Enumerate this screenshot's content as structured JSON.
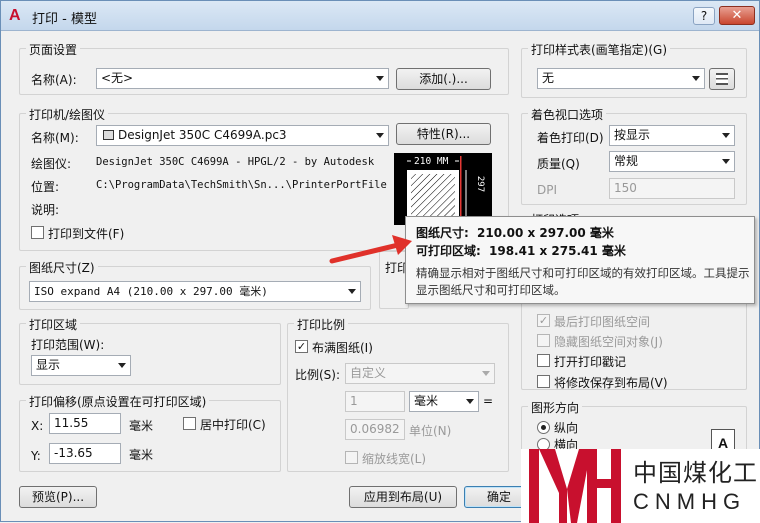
{
  "window": {
    "title": "打印 - 模型",
    "help": "?",
    "close": "✕",
    "app_icon": "A"
  },
  "page_setup": {
    "group_title": "页面设置",
    "name_label": "名称(A):",
    "name_value": "<无>",
    "add_button": "添加(.)..."
  },
  "printer": {
    "group_title": "打印机/绘图仪",
    "name_label": "名称(M):",
    "name_value": "DesignJet 350C C4699A.pc3",
    "properties_button": "特性(R)...",
    "plotter_label": "绘图仪:",
    "plotter_value": "DesignJet 350C C4699A - HPGL/2 - by Autodesk",
    "location_label": "位置:",
    "location_value": "C:\\ProgramData\\TechSmith\\Sn...\\PrinterPortFile",
    "description_label": "说明:",
    "print_to_file_label": "打印到文件(F)",
    "preview_width": "210 MM",
    "preview_height": "297"
  },
  "paper_size": {
    "group_title": "图纸尺寸(Z)",
    "value": "ISO expand A4 (210.00 x 297.00 毫米)",
    "copies_partial": "打印"
  },
  "plot_area": {
    "group_title": "打印区域",
    "range_label": "打印范围(W):",
    "range_value": "显示"
  },
  "plot_offset": {
    "group_title": "打印偏移(原点设置在可打印区域)",
    "x_label": "X:",
    "x_value": "11.55",
    "x_unit": "毫米",
    "y_label": "Y:",
    "y_value": "-13.65",
    "y_unit": "毫米",
    "center_label": "居中打印(C)"
  },
  "plot_scale": {
    "group_title": "打印比例",
    "fit_label": "布满图纸(I)",
    "scale_label": "比例(S):",
    "scale_value": "自定义",
    "value1": "1",
    "unit_value": "毫米",
    "equals": "=",
    "value2": "0.06982",
    "unit_label": "单位(N)",
    "lineweights_label": "缩放线宽(L)"
  },
  "plot_style": {
    "group_title": "打印样式表(画笔指定)(G)",
    "value": "无"
  },
  "shaded_viewport": {
    "group_title": "着色视口选项",
    "shade_label": "着色打印(D)",
    "shade_value": "按显示",
    "quality_label": "质量(Q)",
    "quality_value": "常规",
    "dpi_label": "DPI",
    "dpi_value": "150"
  },
  "plot_options": {
    "group_title": "打印选项",
    "last_paperspace": "最后打印图纸空间",
    "hide_objects": "隐藏图纸空间对象(J)",
    "stamp_on": "打开打印戳记",
    "save_changes": "将修改保存到布局(V)"
  },
  "orientation": {
    "group_title": "图形方向",
    "portrait": "纵向",
    "landscape": "横向"
  },
  "tooltip": {
    "paper_size_label": "图纸尺寸:",
    "paper_size_value": "210.00 x 297.00 毫米",
    "printable_label": "可打印区域:",
    "printable_value": "198.41 x 275.41 毫米",
    "description": "精确显示相对于图纸尺寸和可打印区域的有效打印区域。工具提示显示图纸尺寸和可打印区域。"
  },
  "footer": {
    "preview_button": "预览(P)...",
    "apply_button": "应用到布局(U)",
    "ok_button": "确定"
  },
  "watermark": {
    "logo_letters": "MH",
    "cn_text": "中国煤化工",
    "en_text": "CNMHG",
    "red": "#c8102e"
  }
}
